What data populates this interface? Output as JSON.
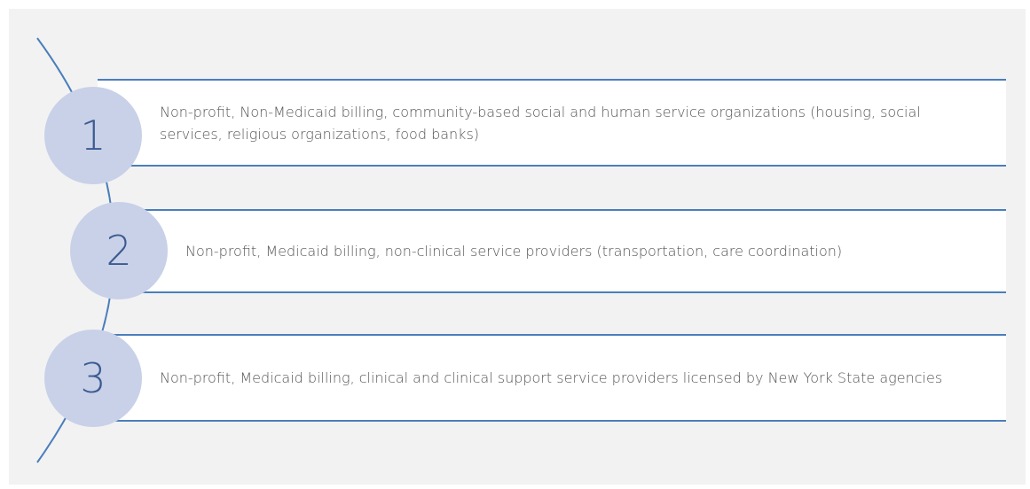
{
  "items": [
    {
      "number": "1",
      "text": "Non-profit, Non-Medicaid billing, community-based social and human service organizations (housing, social services, religious organizations, food banks)"
    },
    {
      "number": "2",
      "text": "Non-profit, Medicaid billing, non-clinical service providers (transportation, care coordination)"
    },
    {
      "number": "3",
      "text": "Non-profit, Medicaid billing, clinical and clinical support service providers licensed by New York State agencies"
    }
  ],
  "colors": {
    "background": "#f2f2f2",
    "accent_line": "#4a7ebb",
    "circle_fill": "#c8d1e8",
    "number_color": "#3b5a8f",
    "text_color": "#555555"
  }
}
